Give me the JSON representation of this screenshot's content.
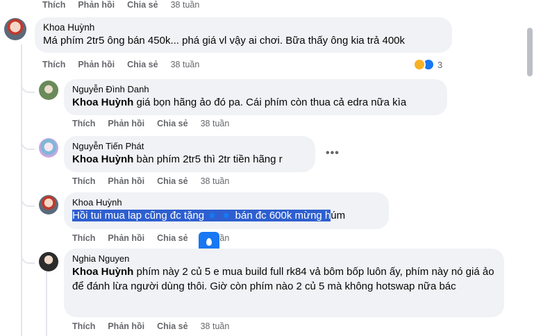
{
  "action_labels": {
    "like": "Thích",
    "reply": "Phản hồi",
    "share": "Chia sẻ"
  },
  "top_actions": {
    "time": "38 tuần"
  },
  "main_comment": {
    "author": "Khoa Huỳnh",
    "text": "Má phím 2tr5 ông bán 450k... phá giá vl vậy ai chơi. Bữa thấy ông kia trả 400k",
    "time": "38 tuần",
    "reaction_count": "3"
  },
  "replies": [
    {
      "author": "Nguyễn Đình Danh",
      "mention": "Khoa Huỳnh",
      "text": " giá bọn hãng ảo đó pa. Cái phím còn thua cả edra nữa kìa",
      "time": "38 tuần"
    },
    {
      "author": "Nguyễn Tiến Phát",
      "mention": "Khoa Huỳnh",
      "text": " bàn phím 2tr5 thì 2tr tiền hãng r",
      "time": "38 tuần",
      "more": "•••"
    },
    {
      "author": "Khoa Huỳnh",
      "text_part1": "Hồi tui mua lap cũng đc tặng ",
      "text_part2": " bán đc 600k mừng h",
      "text_part3": "úm",
      "time": "38 tuần"
    },
    {
      "author": "Nghia Nguyen",
      "mention": "Khoa Huỳnh",
      "text": " phím này 2 củ 5 e mua build full rk84 vả bôm bốp luôn ấy, phím này nó giá ảo để đánh lừa người dùng thôi. Giờ còn phím nào 2 củ 5 mà không hotswap nữa bác",
      "time": "38 tuần"
    }
  ],
  "colors": {
    "bubble": "#f0f2f5",
    "selection": "#2e5fd0",
    "muted": "#65676b",
    "accent": "#1877f2"
  }
}
